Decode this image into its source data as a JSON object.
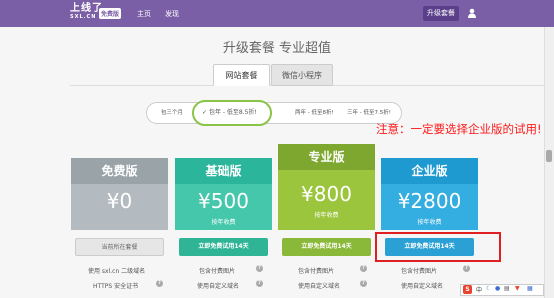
{
  "header": {
    "logo_main": "上线了",
    "logo_sub": "SXL.CN",
    "badge": "免费版",
    "nav": [
      "主页",
      "发现"
    ],
    "upgrade_button": "升级套餐",
    "user_icon": "user-icon"
  },
  "title": "升级套餐 专业超值",
  "tabs": [
    {
      "label": "网站套餐",
      "active": true
    },
    {
      "label": "微信小程序",
      "active": false
    }
  ],
  "periods": [
    {
      "label": "包三个月",
      "active": false
    },
    {
      "label": "包年 - 低至8.5折!",
      "active": true
    },
    {
      "label": "两年 - 低至8折!",
      "active": false
    },
    {
      "label": "三年 - 低至7.5折!",
      "active": false
    }
  ],
  "annotation": "注意：一定要选择企业版的试用!",
  "plans": [
    {
      "name": "免费版",
      "price": "¥0",
      "unit": "",
      "button": "当前所在套餐",
      "head_color": "#9aa3a8",
      "body_color": "#b3bbc0",
      "btn_color": "#e6e6e6",
      "btn_text_color": "#666666",
      "features": [
        "使用 sxl.cn 二级域名",
        "HTTPS 安全证书"
      ]
    },
    {
      "name": "基础版",
      "price": "¥500",
      "unit": "按年收费",
      "button": "立即免费试用14天",
      "head_color": "#2bb59a",
      "body_color": "#45c7ab",
      "btn_color": "#2fb596",
      "btn_text_color": "#ffffff",
      "features": [
        "包含付费图片",
        "使用自定义域名"
      ]
    },
    {
      "name": "专业版",
      "price": "¥800",
      "unit": "按年收费",
      "button": "立即免费试用14天",
      "head_color": "#7ea72f",
      "body_color": "#9bc53d",
      "btn_color": "#8ab838",
      "btn_text_color": "#ffffff",
      "features": [
        "包含付费图片",
        "使用自定义域名"
      ]
    },
    {
      "name": "企业版",
      "price": "¥2800",
      "unit": "按年收费",
      "button": "立即免费试用14天",
      "head_color": "#1f9ad1",
      "body_color": "#34ade0",
      "btn_color": "#2aa0d4",
      "btn_text_color": "#ffffff",
      "features": [
        "包含付费图片",
        "使用自定义域名"
      ]
    }
  ],
  "help_mark": "?",
  "ime": {
    "label": "中",
    "icons": [
      "moon-icon",
      "mic-icon",
      "keyboard-icon",
      "shirt-icon",
      "grid-icon"
    ]
  }
}
